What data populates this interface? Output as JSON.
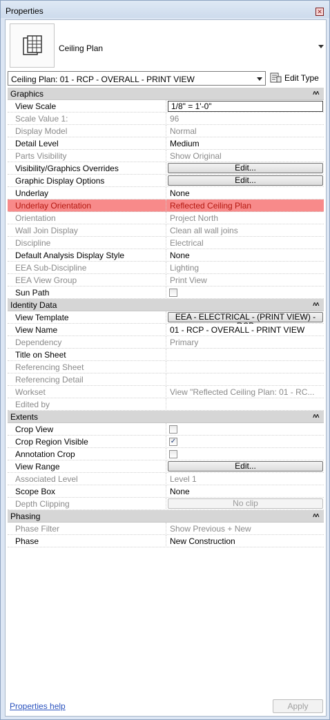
{
  "window": {
    "title": "Properties"
  },
  "type_selector": {
    "name": "Ceiling Plan"
  },
  "view_selector": {
    "value": "Ceiling Plan: 01 - RCP - OVERALL - PRINT VIEW",
    "edit_type_label": "Edit Type"
  },
  "colors": {
    "highlight": "#f88a8a",
    "highlight_text": "#b4170f",
    "section_bg": "#d6d6d6"
  },
  "sections": [
    {
      "title": "Graphics",
      "rows": [
        {
          "name": "View Scale",
          "value": "1/8\" = 1'-0\"",
          "kind": "input",
          "dim": false
        },
        {
          "name": "Scale Value    1:",
          "value": "96",
          "kind": "text",
          "dim": true
        },
        {
          "name": "Display Model",
          "value": "Normal",
          "kind": "text",
          "dim": true
        },
        {
          "name": "Detail Level",
          "value": "Medium",
          "kind": "text",
          "dim": false
        },
        {
          "name": "Parts Visibility",
          "value": "Show Original",
          "kind": "text",
          "dim": true
        },
        {
          "name": "Visibility/Graphics Overrides",
          "value": "Edit...",
          "kind": "button",
          "dim": false
        },
        {
          "name": "Graphic Display Options",
          "value": "Edit...",
          "kind": "button",
          "dim": false
        },
        {
          "name": "Underlay",
          "value": "None",
          "kind": "text",
          "dim": false
        },
        {
          "name": "Underlay Orientation",
          "value": "Reflected Ceiling Plan",
          "kind": "text",
          "dim": false,
          "highlight": true
        },
        {
          "name": "Orientation",
          "value": "Project North",
          "kind": "text",
          "dim": true
        },
        {
          "name": "Wall Join Display",
          "value": "Clean all wall joins",
          "kind": "text",
          "dim": true
        },
        {
          "name": "Discipline",
          "value": "Electrical",
          "kind": "text",
          "dim": true
        },
        {
          "name": "Default Analysis Display Style",
          "value": "None",
          "kind": "text",
          "dim": false
        },
        {
          "name": "EEA Sub-Discipline",
          "value": "Lighting",
          "kind": "text",
          "dim": true
        },
        {
          "name": "EEA View Group",
          "value": "Print View",
          "kind": "text",
          "dim": true
        },
        {
          "name": "Sun Path",
          "value": "",
          "kind": "checkbox",
          "checked": false,
          "dim": false
        }
      ]
    },
    {
      "title": "Identity Data",
      "rows": [
        {
          "name": "View Template",
          "value": "EEA - ELECTRICAL - (PRINT VIEW) - RCP",
          "kind": "button",
          "dim": false
        },
        {
          "name": "View Name",
          "value": "01 - RCP - OVERALL - PRINT VIEW",
          "kind": "text",
          "dim": false
        },
        {
          "name": "Dependency",
          "value": "Primary",
          "kind": "text",
          "dim": true
        },
        {
          "name": "Title on Sheet",
          "value": "",
          "kind": "text",
          "dim": false
        },
        {
          "name": "Referencing Sheet",
          "value": "",
          "kind": "text",
          "dim": true
        },
        {
          "name": "Referencing Detail",
          "value": "",
          "kind": "text",
          "dim": true
        },
        {
          "name": "Workset",
          "value": "View \"Reflected Ceiling Plan: 01 - RC...",
          "kind": "text",
          "dim": true
        },
        {
          "name": "Edited by",
          "value": "",
          "kind": "text",
          "dim": true
        }
      ]
    },
    {
      "title": "Extents",
      "rows": [
        {
          "name": "Crop View",
          "value": "",
          "kind": "checkbox",
          "checked": false,
          "dim": false
        },
        {
          "name": "Crop Region Visible",
          "value": "",
          "kind": "checkbox",
          "checked": true,
          "dim": false
        },
        {
          "name": "Annotation Crop",
          "value": "",
          "kind": "checkbox",
          "checked": false,
          "dim": false
        },
        {
          "name": "View Range",
          "value": "Edit...",
          "kind": "button",
          "dim": false
        },
        {
          "name": "Associated Level",
          "value": "Level 1",
          "kind": "text",
          "dim": true
        },
        {
          "name": "Scope Box",
          "value": "None",
          "kind": "text",
          "dim": false
        },
        {
          "name": "Depth Clipping",
          "value": "No clip",
          "kind": "button",
          "dim": true,
          "disabled": true
        }
      ]
    },
    {
      "title": "Phasing",
      "rows": [
        {
          "name": "Phase Filter",
          "value": "Show Previous + New",
          "kind": "text",
          "dim": true
        },
        {
          "name": "Phase",
          "value": "New Construction",
          "kind": "text",
          "dim": false
        }
      ]
    }
  ],
  "footer": {
    "help_link": "Properties help",
    "apply_label": "Apply"
  }
}
